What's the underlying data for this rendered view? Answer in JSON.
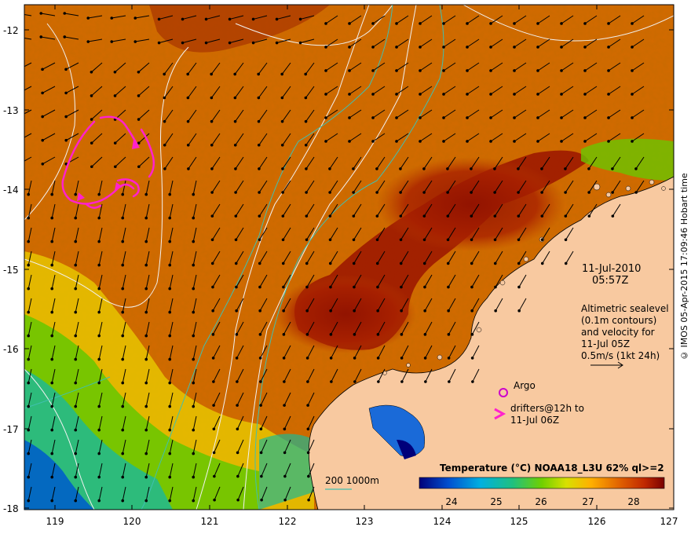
{
  "map": {
    "lon_ticks": [
      "119",
      "120",
      "121",
      "122",
      "123",
      "124",
      "125",
      "126",
      "127"
    ],
    "lat_ticks": [
      "-12",
      "-13",
      "-14",
      "-15",
      "-16",
      "-17",
      "-18"
    ],
    "lon_range": [
      118.6,
      127.0
    ],
    "lat_range": [
      -11.7,
      -18.0
    ]
  },
  "annotations": {
    "date": "11-Jul-2010",
    "time": "05:57Z",
    "altimetry_lines": [
      "Altimetric sealevel",
      "(0.1m contours)",
      "and velocity for",
      "11-Jul 05Z",
      "0.5m/s (1kt 24h)"
    ],
    "argo_label": "Argo",
    "drifters_lines": [
      "drifters@12h to",
      "11-Jul 06Z"
    ],
    "bathymetry_label": "200  1000m"
  },
  "colorbar": {
    "title": "Temperature (°C) NOAA18_L3U 62% ql>=2",
    "ticks": [
      "24",
      "25",
      "26",
      "27",
      "28"
    ],
    "range": [
      23.6,
      28.6
    ]
  },
  "credit": "© IMOS 05-Apr-2015 17:09:46 Hobart time",
  "colors": {
    "land": "#f8c9a0",
    "sea_warm": "#d16600",
    "sea_hot": "#9c1a00",
    "contour": "#f2f2f2",
    "bathy": "#40c0b0",
    "drifter": "#ff22cc",
    "argo": "#cc00cc"
  }
}
